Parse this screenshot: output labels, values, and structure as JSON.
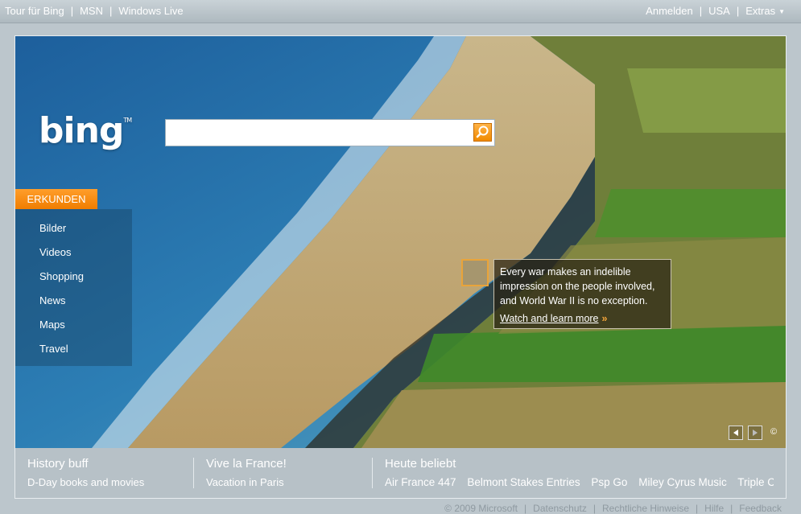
{
  "topbar": {
    "left_links": [
      "Tour für Bing",
      "MSN",
      "Windows Live"
    ],
    "right_links": [
      "Anmelden",
      "USA",
      "Extras"
    ]
  },
  "logo": {
    "text": "bing",
    "tm": "TM"
  },
  "search": {
    "value": "",
    "placeholder": ""
  },
  "explore": {
    "tab_label": "ERKUNDEN",
    "items": [
      "Bilder",
      "Videos",
      "Shopping",
      "News",
      "Maps",
      "Travel"
    ]
  },
  "hotspot": {
    "line1": "Every war makes an indelible",
    "line2": "impression on the people involved,",
    "line3": "and World War II is no exception.",
    "link": "Watch and learn more",
    "arrow": "»"
  },
  "image_nav": {
    "copyright": "©"
  },
  "bottom": {
    "col1": {
      "title": "History buff",
      "link": "D-Day books and movies"
    },
    "col2": {
      "title": "Vive la France!",
      "link": "Vacation in Paris"
    },
    "col3": {
      "title": "Heute beliebt",
      "links": [
        "Air France 447",
        "Belmont Stakes Entries",
        "Psp Go",
        "Miley Cyrus Music",
        "Triple Cro"
      ]
    }
  },
  "footer": [
    "© 2009 Microsoft",
    "Datenschutz",
    "Rechtliche Hinweise",
    "Hilfe",
    "Feedback"
  ],
  "colors": {
    "accent": "#f08a00",
    "topbar": "#b5c0c6",
    "page_bg": "#bcc6cc"
  }
}
